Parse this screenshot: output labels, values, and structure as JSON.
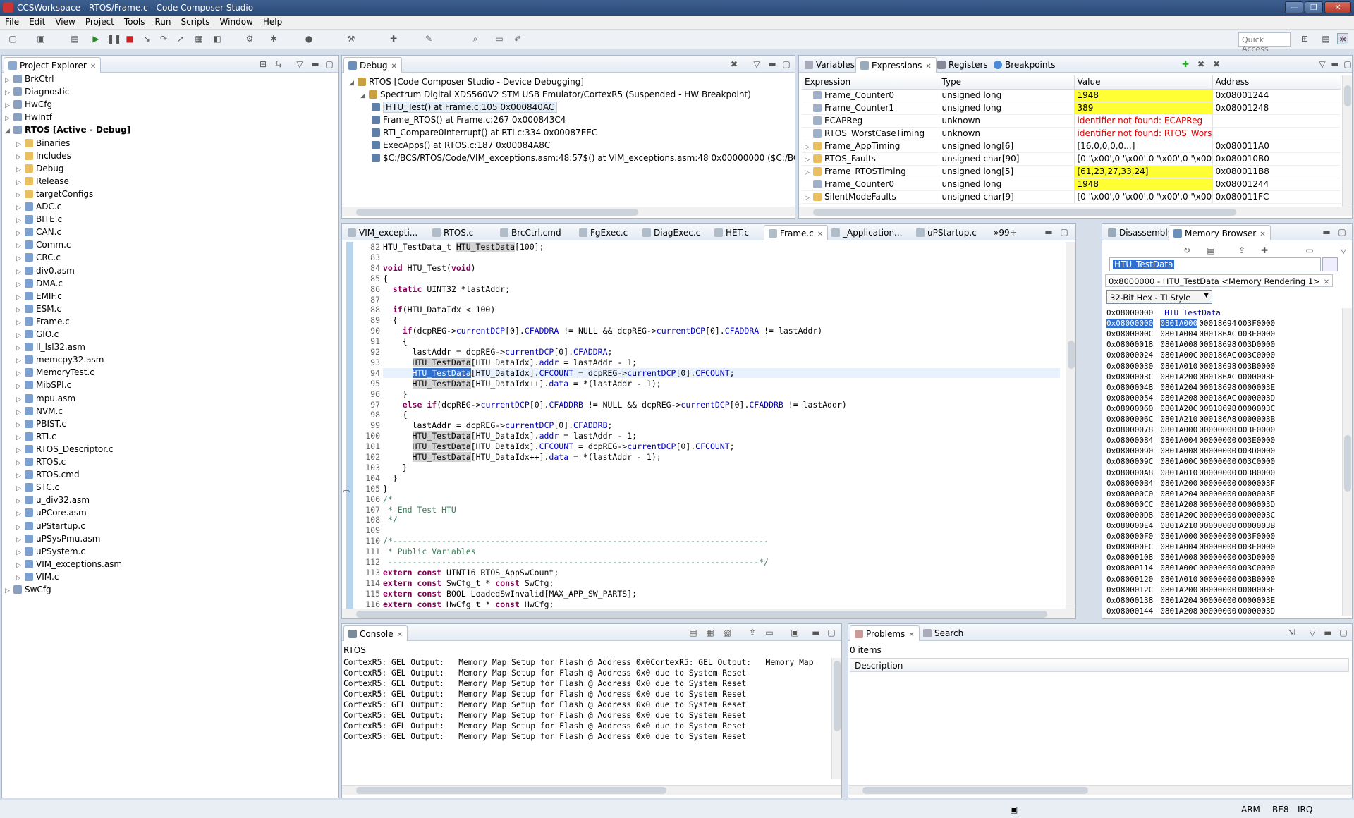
{
  "window": {
    "title": "CCSWorkspace - RTOS/Frame.c - Code Composer Studio",
    "buttons": [
      "—",
      "❐",
      "✕"
    ]
  },
  "menu": [
    "File",
    "Edit",
    "View",
    "Project",
    "Tools",
    "Run",
    "Scripts",
    "Window",
    "Help"
  ],
  "quick_access": "Quick Access",
  "project_explorer": {
    "tab": "Project Explorer",
    "items": [
      {
        "label": "BrkCtrl",
        "level": 0,
        "open": false,
        "type": "project"
      },
      {
        "label": "Diagnostic",
        "level": 0,
        "open": false,
        "type": "project"
      },
      {
        "label": "HwCfg",
        "level": 0,
        "open": false,
        "type": "project"
      },
      {
        "label": "HwIntf",
        "level": 0,
        "open": false,
        "type": "project"
      },
      {
        "label": "RTOS  [Active - Debug]",
        "level": 0,
        "open": true,
        "type": "project",
        "bold": true
      },
      {
        "label": "Binaries",
        "level": 1,
        "open": false,
        "type": "folder"
      },
      {
        "label": "Includes",
        "level": 1,
        "open": false,
        "type": "folder"
      },
      {
        "label": "Debug",
        "level": 1,
        "open": false,
        "type": "folder"
      },
      {
        "label": "Release",
        "level": 1,
        "open": false,
        "type": "folder"
      },
      {
        "label": "targetConfigs",
        "level": 1,
        "open": false,
        "type": "folder"
      },
      {
        "label": "ADC.c",
        "level": 1,
        "open": false,
        "type": "file"
      },
      {
        "label": "BITE.c",
        "level": 1,
        "open": false,
        "type": "file"
      },
      {
        "label": "CAN.c",
        "level": 1,
        "open": false,
        "type": "file"
      },
      {
        "label": "Comm.c",
        "level": 1,
        "open": false,
        "type": "file"
      },
      {
        "label": "CRC.c",
        "level": 1,
        "open": false,
        "type": "file"
      },
      {
        "label": "div0.asm",
        "level": 1,
        "open": false,
        "type": "file"
      },
      {
        "label": "DMA.c",
        "level": 1,
        "open": false,
        "type": "file"
      },
      {
        "label": "EMIF.c",
        "level": 1,
        "open": false,
        "type": "file"
      },
      {
        "label": "ESM.c",
        "level": 1,
        "open": false,
        "type": "file"
      },
      {
        "label": "Frame.c",
        "level": 1,
        "open": false,
        "type": "file"
      },
      {
        "label": "GIO.c",
        "level": 1,
        "open": false,
        "type": "file"
      },
      {
        "label": "ll_lsl32.asm",
        "level": 1,
        "open": false,
        "type": "file"
      },
      {
        "label": "memcpy32.asm",
        "level": 1,
        "open": false,
        "type": "file"
      },
      {
        "label": "MemoryTest.c",
        "level": 1,
        "open": false,
        "type": "file"
      },
      {
        "label": "MibSPI.c",
        "level": 1,
        "open": false,
        "type": "file"
      },
      {
        "label": "mpu.asm",
        "level": 1,
        "open": false,
        "type": "file"
      },
      {
        "label": "NVM.c",
        "level": 1,
        "open": false,
        "type": "file"
      },
      {
        "label": "PBIST.c",
        "level": 1,
        "open": false,
        "type": "file"
      },
      {
        "label": "RTI.c",
        "level": 1,
        "open": false,
        "type": "file"
      },
      {
        "label": "RTOS_Descriptor.c",
        "level": 1,
        "open": false,
        "type": "file"
      },
      {
        "label": "RTOS.c",
        "level": 1,
        "open": false,
        "type": "file"
      },
      {
        "label": "RTOS.cmd",
        "level": 1,
        "open": false,
        "type": "file"
      },
      {
        "label": "STC.c",
        "level": 1,
        "open": false,
        "type": "file"
      },
      {
        "label": "u_div32.asm",
        "level": 1,
        "open": false,
        "type": "file"
      },
      {
        "label": "uPCore.asm",
        "level": 1,
        "open": false,
        "type": "file"
      },
      {
        "label": "uPStartup.c",
        "level": 1,
        "open": false,
        "type": "file"
      },
      {
        "label": "uPSysPmu.asm",
        "level": 1,
        "open": false,
        "type": "file"
      },
      {
        "label": "uPSystem.c",
        "level": 1,
        "open": false,
        "type": "file"
      },
      {
        "label": "VIM_exceptions.asm",
        "level": 1,
        "open": false,
        "type": "file"
      },
      {
        "label": "VIM.c",
        "level": 1,
        "open": false,
        "type": "file"
      },
      {
        "label": "SwCfg",
        "level": 0,
        "open": false,
        "type": "project"
      }
    ]
  },
  "debug": {
    "tab": "Debug",
    "items": [
      {
        "label": "RTOS [Code Composer Studio - Device Debugging]",
        "level": 0
      },
      {
        "label": "Spectrum Digital XDS560V2 STM USB Emulator/CortexR5 (Suspended - HW Breakpoint)",
        "level": 1
      },
      {
        "label": "HTU_Test() at Frame.c:105 0x000840AC",
        "level": 2,
        "selected": true
      },
      {
        "label": "Frame_RTOS() at Frame.c:267 0x000843C4",
        "level": 2
      },
      {
        "label": "RTI_Compare0Interrupt() at RTI.c:334 0x00087EEC",
        "level": 2
      },
      {
        "label": "ExecApps() at RTOS.c:187 0x00084A8C",
        "level": 2
      },
      {
        "label": "$C:/BCS/RTOS/Code/VIM_exceptions.asm:48:57$() at VIM_exceptions.asm:48 0x00000000  ($C:/BCS/RTOS/Co",
        "level": 2
      }
    ]
  },
  "expressions": {
    "tabs": [
      "Variables",
      "Expressions",
      "Registers",
      "Breakpoints"
    ],
    "columns": [
      "Expression",
      "Type",
      "Value",
      "Address"
    ],
    "rows": [
      {
        "name": "Frame_Counter0",
        "type": "unsigned long",
        "value": "1948",
        "address": "0x08001244",
        "changed": true,
        "expand": false
      },
      {
        "name": "Frame_Counter1",
        "type": "unsigned long",
        "value": "389",
        "address": "0x08001248",
        "changed": true,
        "expand": false
      },
      {
        "name": "ECAPReg",
        "type": "unknown",
        "value": "identifier not found: ECAPReg",
        "address": "",
        "error": true,
        "expand": false
      },
      {
        "name": "RTOS_WorstCaseTiming",
        "type": "unknown",
        "value": "identifier not found: RTOS_Worst...",
        "address": "",
        "error": true,
        "expand": false
      },
      {
        "name": "Frame_AppTiming",
        "type": "unsigned long[6]",
        "value": "[16,0,0,0,0...]",
        "address": "0x080011A0",
        "expand": true
      },
      {
        "name": "RTOS_Faults",
        "type": "unsigned char[90]",
        "value": "[0 '\\x00',0 '\\x00',0 '\\x00',0 '\\x00',0 '...",
        "address": "0x080010B0",
        "expand": true
      },
      {
        "name": "Frame_RTOSTiming",
        "type": "unsigned long[5]",
        "value": "[61,23,27,33,24]",
        "address": "0x080011B8",
        "changed": true,
        "expand": true
      },
      {
        "name": "Frame_Counter0",
        "type": "unsigned long",
        "value": "1948",
        "address": "0x08001244",
        "changed": true,
        "expand": false
      },
      {
        "name": "SilentModeFaults",
        "type": "unsigned char[9]",
        "value": "[0 '\\x00',0 '\\x00',0 '\\x00',0 '\\x00',0 '...",
        "address": "0x080011FC",
        "expand": true
      }
    ]
  },
  "editor": {
    "tabs": [
      "VIM_excepti...",
      "RTOS.c",
      "BrcCtrl.cmd",
      "FgExec.c",
      "DiagExec.c",
      "HET.c",
      "Frame.c",
      "_Application...",
      "uPStartup.c",
      "»99+"
    ],
    "active_tab": 6,
    "lines": [
      {
        "n": "82",
        "t": "HTU_TestData_t HTU_TestData[100];"
      },
      {
        "n": "83",
        "t": ""
      },
      {
        "n": "84",
        "t": "void HTU_Test(void)"
      },
      {
        "n": "85",
        "t": "{"
      },
      {
        "n": "86",
        "t": "  static UINT32 *lastAddr;"
      },
      {
        "n": "87",
        "t": ""
      },
      {
        "n": "88",
        "t": "  if(HTU_DataIdx < 100)"
      },
      {
        "n": "89",
        "t": "  {"
      },
      {
        "n": "90",
        "t": "    if(dcpREG->currentDCP[0].CFADDRA != NULL && dcpREG->currentDCP[0].CFADDRA != lastAddr)"
      },
      {
        "n": "91",
        "t": "    {"
      },
      {
        "n": "92",
        "t": "      lastAddr = dcpREG->currentDCP[0].CFADDRA;"
      },
      {
        "n": "93",
        "t": "      HTU_TestData[HTU_DataIdx].addr = lastAddr - 1;"
      },
      {
        "n": "94",
        "t": "      HTU_TestData[HTU_DataIdx].CFCOUNT = dcpREG->currentDCP[0].CFCOUNT;"
      },
      {
        "n": "95",
        "t": "      HTU_TestData[HTU_DataIdx++].data = *(lastAddr - 1);"
      },
      {
        "n": "96",
        "t": "    }"
      },
      {
        "n": "97",
        "t": "    else if(dcpREG->currentDCP[0].CFADDRB != NULL && dcpREG->currentDCP[0].CFADDRB != lastAddr)"
      },
      {
        "n": "98",
        "t": "    {"
      },
      {
        "n": "99",
        "t": "      lastAddr = dcpREG->currentDCP[0].CFADDRB;"
      },
      {
        "n": "100",
        "t": "      HTU_TestData[HTU_DataIdx].addr = lastAddr - 1;"
      },
      {
        "n": "101",
        "t": "      HTU_TestData[HTU_DataIdx].CFCOUNT = dcpREG->currentDCP[0].CFCOUNT;"
      },
      {
        "n": "102",
        "t": "      HTU_TestData[HTU_DataIdx++].data = *(lastAddr - 1);"
      },
      {
        "n": "103",
        "t": "    }"
      },
      {
        "n": "104",
        "t": "  }"
      },
      {
        "n": "105",
        "t": "}"
      },
      {
        "n": "106",
        "t": "/*"
      },
      {
        "n": "107",
        "t": " * End Test HTU"
      },
      {
        "n": "108",
        "t": " */"
      },
      {
        "n": "109",
        "t": ""
      },
      {
        "n": "110",
        "t": "/*-----------------------------------------------------------------------------"
      },
      {
        "n": "111",
        "t": " * Public Variables"
      },
      {
        "n": "112",
        "t": " ----------------------------------------------------------------------------*/"
      },
      {
        "n": "113",
        "t": "extern const UINT16 RTOS_AppSwCount;"
      },
      {
        "n": "114",
        "t": "extern const SwCfg_t * const SwCfg;"
      },
      {
        "n": "115",
        "t": "extern const BOOL LoadedSwInvalid[MAX_APP_SW_PARTS];"
      },
      {
        "n": "116",
        "t": "extern const HwCfg_t * const HwCfg;"
      }
    ]
  },
  "memory": {
    "tabs": [
      "Disassembly",
      "Memory Browser"
    ],
    "search": "HTU_TestData",
    "rendering_tab": "0x8000000 - HTU_TestData <Memory Rendering 1>",
    "format": "32-Bit Hex - TI Style",
    "label_row": {
      "addr": "0x08000000",
      "label": "HTU_TestData"
    },
    "rows": [
      {
        "a": "0x08000000",
        "w": [
          "0801A000",
          "00018694",
          "003F0000"
        ]
      },
      {
        "a": "0x0800000C",
        "w": [
          "0801A004",
          "000186AC",
          "003E0000"
        ]
      },
      {
        "a": "0x08000018",
        "w": [
          "0801A008",
          "00018698",
          "003D0000"
        ]
      },
      {
        "a": "0x08000024",
        "w": [
          "0801A00C",
          "000186AC",
          "003C0000"
        ]
      },
      {
        "a": "0x08000030",
        "w": [
          "0801A010",
          "00018698",
          "003B0000"
        ]
      },
      {
        "a": "0x0800003C",
        "w": [
          "0801A200",
          "000186AC",
          "0000003F"
        ]
      },
      {
        "a": "0x08000048",
        "w": [
          "0801A204",
          "00018698",
          "0000003E"
        ]
      },
      {
        "a": "0x08000054",
        "w": [
          "0801A208",
          "000186AC",
          "0000003D"
        ]
      },
      {
        "a": "0x08000060",
        "w": [
          "0801A20C",
          "00018698",
          "0000003C"
        ]
      },
      {
        "a": "0x0800006C",
        "w": [
          "0801A210",
          "000186A8",
          "0000003B"
        ]
      },
      {
        "a": "0x08000078",
        "w": [
          "0801A000",
          "00000000",
          "003F0000"
        ]
      },
      {
        "a": "0x08000084",
        "w": [
          "0801A004",
          "00000000",
          "003E0000"
        ]
      },
      {
        "a": "0x08000090",
        "w": [
          "0801A008",
          "00000000",
          "003D0000"
        ]
      },
      {
        "a": "0x0800009C",
        "w": [
          "0801A00C",
          "00000000",
          "003C0000"
        ]
      },
      {
        "a": "0x080000A8",
        "w": [
          "0801A010",
          "00000000",
          "003B0000"
        ]
      },
      {
        "a": "0x080000B4",
        "w": [
          "0801A200",
          "00000000",
          "0000003F"
        ]
      },
      {
        "a": "0x080000C0",
        "w": [
          "0801A204",
          "00000000",
          "0000003E"
        ]
      },
      {
        "a": "0x080000CC",
        "w": [
          "0801A208",
          "00000000",
          "0000003D"
        ]
      },
      {
        "a": "0x080000D8",
        "w": [
          "0801A20C",
          "00000000",
          "0000003C"
        ]
      },
      {
        "a": "0x080000E4",
        "w": [
          "0801A210",
          "00000000",
          "0000003B"
        ]
      },
      {
        "a": "0x080000F0",
        "w": [
          "0801A000",
          "00000000",
          "003F0000"
        ]
      },
      {
        "a": "0x080000FC",
        "w": [
          "0801A004",
          "00000000",
          "003E0000"
        ]
      },
      {
        "a": "0x08000108",
        "w": [
          "0801A008",
          "00000000",
          "003D0000"
        ]
      },
      {
        "a": "0x08000114",
        "w": [
          "0801A00C",
          "00000000",
          "003C0000"
        ]
      },
      {
        "a": "0x08000120",
        "w": [
          "0801A010",
          "00000000",
          "003B0000"
        ]
      },
      {
        "a": "0x0800012C",
        "w": [
          "0801A200",
          "00000000",
          "0000003F"
        ]
      },
      {
        "a": "0x08000138",
        "w": [
          "0801A204",
          "00000000",
          "0000003E"
        ]
      },
      {
        "a": "0x08000144",
        "w": [
          "0801A208",
          "00000000",
          "0000003D"
        ]
      }
    ]
  },
  "console": {
    "tab": "Console",
    "name": "RTOS",
    "lines": [
      "CortexR5: GEL Output:   Memory Map Setup for Flash @ Address 0x0CortexR5: GEL Output:   Memory Map",
      "CortexR5: GEL Output:   Memory Map Setup for Flash @ Address 0x0 due to System Reset",
      "CortexR5: GEL Output:   Memory Map Setup for Flash @ Address 0x0 due to System Reset",
      "CortexR5: GEL Output:   Memory Map Setup for Flash @ Address 0x0 due to System Reset",
      "CortexR5: GEL Output:   Memory Map Setup for Flash @ Address 0x0 due to System Reset",
      "CortexR5: GEL Output:   Memory Map Setup for Flash @ Address 0x0 due to System Reset",
      "CortexR5: GEL Output:   Memory Map Setup for Flash @ Address 0x0 due to System Reset",
      "CortexR5: GEL Output:   Memory Map Setup for Flash @ Address 0x0 due to System Reset"
    ]
  },
  "problems": {
    "tabs": [
      "Problems",
      "Search"
    ],
    "count": "0 items",
    "column": "Description"
  },
  "status": [
    "ARM",
    "BE8",
    "IRQ"
  ],
  "colors": {
    "changed_bg": "#ffff33",
    "error_fg": "#dd0000",
    "keyword": "#7f0055",
    "field": "#0000c0",
    "selection": "#2f6fd0"
  }
}
